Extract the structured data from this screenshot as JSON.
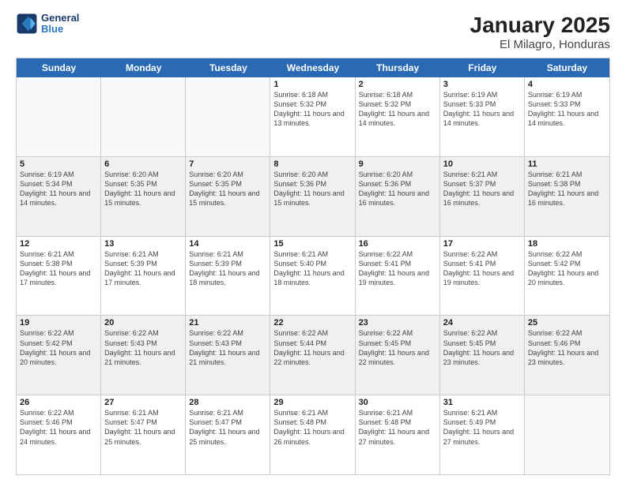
{
  "logo": {
    "line1": "General",
    "line2": "Blue"
  },
  "title": "January 2025",
  "subtitle": "El Milagro, Honduras",
  "days": [
    "Sunday",
    "Monday",
    "Tuesday",
    "Wednesday",
    "Thursday",
    "Friday",
    "Saturday"
  ],
  "weeks": [
    [
      {
        "date": "",
        "sunrise": "",
        "sunset": "",
        "daylight": ""
      },
      {
        "date": "",
        "sunrise": "",
        "sunset": "",
        "daylight": ""
      },
      {
        "date": "",
        "sunrise": "",
        "sunset": "",
        "daylight": ""
      },
      {
        "date": "1",
        "sunrise": "Sunrise: 6:18 AM",
        "sunset": "Sunset: 5:32 PM",
        "daylight": "Daylight: 11 hours and 13 minutes."
      },
      {
        "date": "2",
        "sunrise": "Sunrise: 6:18 AM",
        "sunset": "Sunset: 5:32 PM",
        "daylight": "Daylight: 11 hours and 14 minutes."
      },
      {
        "date": "3",
        "sunrise": "Sunrise: 6:19 AM",
        "sunset": "Sunset: 5:33 PM",
        "daylight": "Daylight: 11 hours and 14 minutes."
      },
      {
        "date": "4",
        "sunrise": "Sunrise: 6:19 AM",
        "sunset": "Sunset: 5:33 PM",
        "daylight": "Daylight: 11 hours and 14 minutes."
      }
    ],
    [
      {
        "date": "5",
        "sunrise": "Sunrise: 6:19 AM",
        "sunset": "Sunset: 5:34 PM",
        "daylight": "Daylight: 11 hours and 14 minutes."
      },
      {
        "date": "6",
        "sunrise": "Sunrise: 6:20 AM",
        "sunset": "Sunset: 5:35 PM",
        "daylight": "Daylight: 11 hours and 15 minutes."
      },
      {
        "date": "7",
        "sunrise": "Sunrise: 6:20 AM",
        "sunset": "Sunset: 5:35 PM",
        "daylight": "Daylight: 11 hours and 15 minutes."
      },
      {
        "date": "8",
        "sunrise": "Sunrise: 6:20 AM",
        "sunset": "Sunset: 5:36 PM",
        "daylight": "Daylight: 11 hours and 15 minutes."
      },
      {
        "date": "9",
        "sunrise": "Sunrise: 6:20 AM",
        "sunset": "Sunset: 5:36 PM",
        "daylight": "Daylight: 11 hours and 16 minutes."
      },
      {
        "date": "10",
        "sunrise": "Sunrise: 6:21 AM",
        "sunset": "Sunset: 5:37 PM",
        "daylight": "Daylight: 11 hours and 16 minutes."
      },
      {
        "date": "11",
        "sunrise": "Sunrise: 6:21 AM",
        "sunset": "Sunset: 5:38 PM",
        "daylight": "Daylight: 11 hours and 16 minutes."
      }
    ],
    [
      {
        "date": "12",
        "sunrise": "Sunrise: 6:21 AM",
        "sunset": "Sunset: 5:38 PM",
        "daylight": "Daylight: 11 hours and 17 minutes."
      },
      {
        "date": "13",
        "sunrise": "Sunrise: 6:21 AM",
        "sunset": "Sunset: 5:39 PM",
        "daylight": "Daylight: 11 hours and 17 minutes."
      },
      {
        "date": "14",
        "sunrise": "Sunrise: 6:21 AM",
        "sunset": "Sunset: 5:39 PM",
        "daylight": "Daylight: 11 hours and 18 minutes."
      },
      {
        "date": "15",
        "sunrise": "Sunrise: 6:21 AM",
        "sunset": "Sunset: 5:40 PM",
        "daylight": "Daylight: 11 hours and 18 minutes."
      },
      {
        "date": "16",
        "sunrise": "Sunrise: 6:22 AM",
        "sunset": "Sunset: 5:41 PM",
        "daylight": "Daylight: 11 hours and 19 minutes."
      },
      {
        "date": "17",
        "sunrise": "Sunrise: 6:22 AM",
        "sunset": "Sunset: 5:41 PM",
        "daylight": "Daylight: 11 hours and 19 minutes."
      },
      {
        "date": "18",
        "sunrise": "Sunrise: 6:22 AM",
        "sunset": "Sunset: 5:42 PM",
        "daylight": "Daylight: 11 hours and 20 minutes."
      }
    ],
    [
      {
        "date": "19",
        "sunrise": "Sunrise: 6:22 AM",
        "sunset": "Sunset: 5:42 PM",
        "daylight": "Daylight: 11 hours and 20 minutes."
      },
      {
        "date": "20",
        "sunrise": "Sunrise: 6:22 AM",
        "sunset": "Sunset: 5:43 PM",
        "daylight": "Daylight: 11 hours and 21 minutes."
      },
      {
        "date": "21",
        "sunrise": "Sunrise: 6:22 AM",
        "sunset": "Sunset: 5:43 PM",
        "daylight": "Daylight: 11 hours and 21 minutes."
      },
      {
        "date": "22",
        "sunrise": "Sunrise: 6:22 AM",
        "sunset": "Sunset: 5:44 PM",
        "daylight": "Daylight: 11 hours and 22 minutes."
      },
      {
        "date": "23",
        "sunrise": "Sunrise: 6:22 AM",
        "sunset": "Sunset: 5:45 PM",
        "daylight": "Daylight: 11 hours and 22 minutes."
      },
      {
        "date": "24",
        "sunrise": "Sunrise: 6:22 AM",
        "sunset": "Sunset: 5:45 PM",
        "daylight": "Daylight: 11 hours and 23 minutes."
      },
      {
        "date": "25",
        "sunrise": "Sunrise: 6:22 AM",
        "sunset": "Sunset: 5:46 PM",
        "daylight": "Daylight: 11 hours and 23 minutes."
      }
    ],
    [
      {
        "date": "26",
        "sunrise": "Sunrise: 6:22 AM",
        "sunset": "Sunset: 5:46 PM",
        "daylight": "Daylight: 11 hours and 24 minutes."
      },
      {
        "date": "27",
        "sunrise": "Sunrise: 6:21 AM",
        "sunset": "Sunset: 5:47 PM",
        "daylight": "Daylight: 11 hours and 25 minutes."
      },
      {
        "date": "28",
        "sunrise": "Sunrise: 6:21 AM",
        "sunset": "Sunset: 5:47 PM",
        "daylight": "Daylight: 11 hours and 25 minutes."
      },
      {
        "date": "29",
        "sunrise": "Sunrise: 6:21 AM",
        "sunset": "Sunset: 5:48 PM",
        "daylight": "Daylight: 11 hours and 26 minutes."
      },
      {
        "date": "30",
        "sunrise": "Sunrise: 6:21 AM",
        "sunset": "Sunset: 5:48 PM",
        "daylight": "Daylight: 11 hours and 27 minutes."
      },
      {
        "date": "31",
        "sunrise": "Sunrise: 6:21 AM",
        "sunset": "Sunset: 5:49 PM",
        "daylight": "Daylight: 11 hours and 27 minutes."
      },
      {
        "date": "",
        "sunrise": "",
        "sunset": "",
        "daylight": ""
      }
    ]
  ]
}
